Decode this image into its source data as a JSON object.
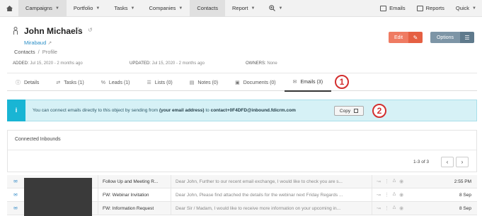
{
  "nav": {
    "items": [
      {
        "label": "Campaigns",
        "active": true
      },
      {
        "label": "Portfolio",
        "active": false
      },
      {
        "label": "Tasks",
        "active": false
      },
      {
        "label": "Companies",
        "active": false
      },
      {
        "label": "Contacts",
        "active": true
      },
      {
        "label": "Report",
        "active": false
      }
    ],
    "emails_label": "Emails",
    "reports_label": "Reports",
    "quick_label": "Quick"
  },
  "contact": {
    "name": "John Michaels",
    "company": "Mirabaud",
    "breadcrumb_root": "Contacts",
    "breadcrumb_current": "Profile"
  },
  "actions": {
    "edit_label": "Edit",
    "options_label": "Options"
  },
  "meta": {
    "added_label": "ADDED:",
    "added_value": "Jul 15, 2020 - 2 months ago",
    "updated_label": "UPDATED:",
    "updated_value": "Jul 15, 2020 - 2 months ago",
    "owners_label": "OWNERS:",
    "owners_value": "None"
  },
  "tabs": [
    {
      "label": "Details",
      "icon": "info-icon"
    },
    {
      "label": "Tasks (1)",
      "icon": "tasks-icon"
    },
    {
      "label": "Leads (1)",
      "icon": "leads-icon"
    },
    {
      "label": "Lists (0)",
      "icon": "list-icon"
    },
    {
      "label": "Notes (0)",
      "icon": "notes-icon"
    },
    {
      "label": "Documents (0)",
      "icon": "documents-icon"
    },
    {
      "label": "Emails (3)",
      "icon": "email-icon",
      "active": true
    }
  ],
  "badges": {
    "one": "1",
    "two": "2"
  },
  "info": {
    "pre": "You can connect emails directly to this object by sending from ",
    "bold1": "(your email address)",
    "mid": " to ",
    "bold2": "contact+0F4DFD@inbound.fdicrm.com",
    "copy_label": "Copy"
  },
  "inbounds": {
    "title": "Connected Inbounds",
    "pager": "1-3 of 3",
    "rows": [
      {
        "subject": "Follow Up and Meeting R...",
        "preview": "Dear John, Further to our recent email exchange, I would like to check you are s...",
        "date": "2:55 PM"
      },
      {
        "subject": "FW: Webinar Invitation",
        "preview": "Dear John, Please find attached the details for the webinar next Friday Regards ...",
        "date": "8 Sep"
      },
      {
        "subject": "FW: Information Request",
        "preview": "Dear Sir / Madam, I would like to receive more information on your upcoming in...",
        "date": "8 Sep"
      }
    ]
  },
  "colors": {
    "accent": "#2b8fc7",
    "edit": "#ef7b62",
    "options": "#7d95a6",
    "info_bg": "#d6f1f6",
    "badge": "#d32f2f"
  }
}
